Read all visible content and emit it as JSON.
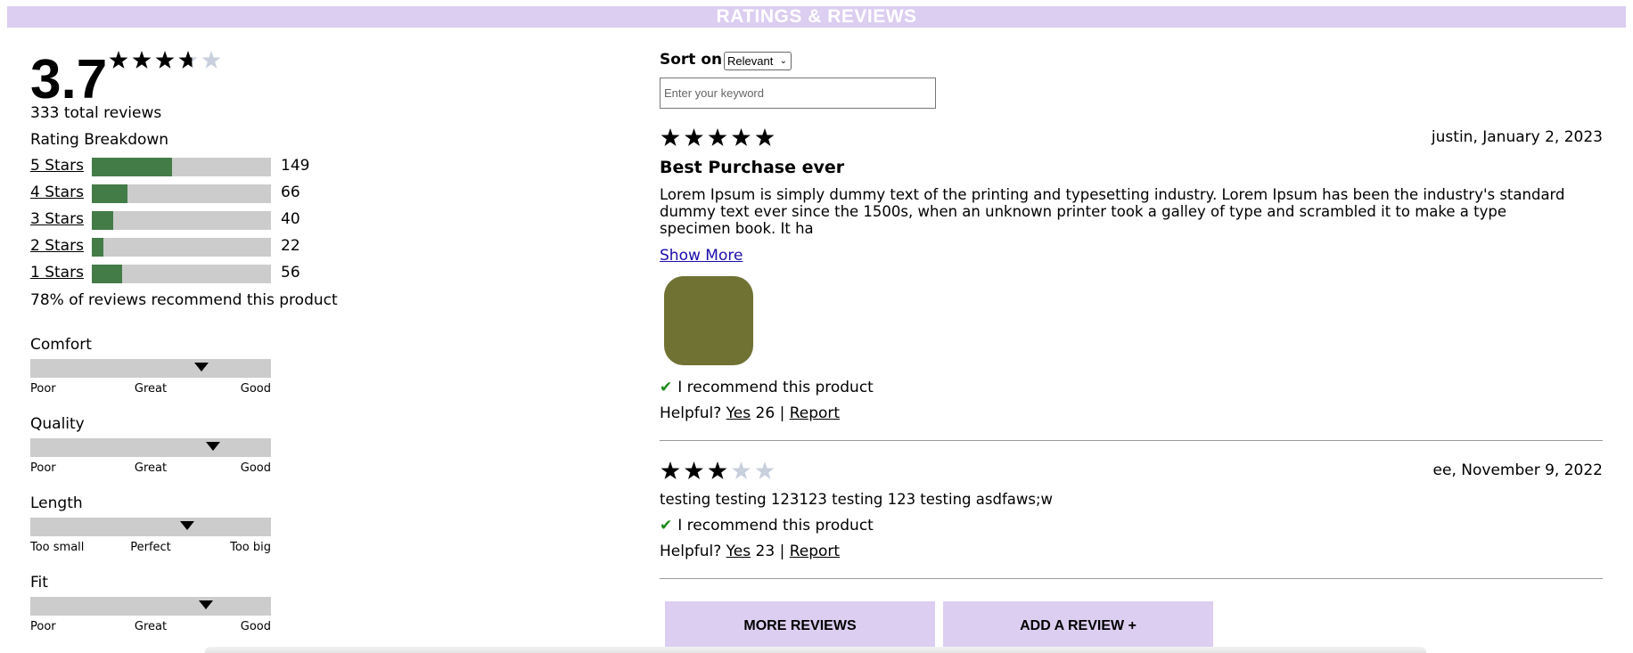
{
  "header": {
    "title": "RATINGS & REVIEWS"
  },
  "summary": {
    "average": "3.7",
    "average_value": 3.7,
    "total_reviews": "333 total reviews",
    "breakdown_title": "Rating Breakdown",
    "breakdown": [
      {
        "label": "5 Stars",
        "count": "149",
        "fraction": 0.447
      },
      {
        "label": "4 Stars",
        "count": "66",
        "fraction": 0.198
      },
      {
        "label": "3 Stars",
        "count": "40",
        "fraction": 0.12
      },
      {
        "label": "2 Stars",
        "count": "22",
        "fraction": 0.066
      },
      {
        "label": "1 Stars",
        "count": "56",
        "fraction": 0.168
      }
    ],
    "recommend_text": "78% of reviews recommend this product"
  },
  "characteristics": [
    {
      "name": "Comfort",
      "low": "Poor",
      "mid": "Great",
      "high": "Good",
      "level": 0.71
    },
    {
      "name": "Quality",
      "low": "Poor",
      "mid": "Great",
      "high": "Good",
      "level": 0.76
    },
    {
      "name": "Length",
      "low": "Too small",
      "mid": "Perfect",
      "high": "Too big",
      "level": 0.65
    },
    {
      "name": "Fit",
      "low": "Poor",
      "mid": "Great",
      "high": "Good",
      "level": 0.73
    }
  ],
  "controls": {
    "sort_label": "Sort on:",
    "sort_value": "Relevant",
    "keyword_placeholder": "Enter your keyword"
  },
  "reviews": [
    {
      "rating": 5,
      "meta": "justin, January 2, 2023",
      "summary": "Best Purchase ever",
      "body": "Lorem Ipsum is simply dummy text of the printing and typesetting industry. Lorem Ipsum has been the industry's standard dummy text ever since the 1500s, when an unknown printer took a galley of type and scrambled it to make a type specimen book. It ha",
      "show_more": "Show More",
      "photo_color": "#707234",
      "recommend": "I recommend this product",
      "helpful_label": "Helpful?",
      "yes_label": "Yes",
      "helpful_count": "26",
      "separator": "|",
      "report_label": "Report"
    },
    {
      "rating": 3,
      "meta": "ee, November 9, 2022",
      "body": "testing testing 123123 testing 123 testing asdfaws;w",
      "recommend": "I recommend this product",
      "helpful_label": "Helpful?",
      "yes_label": "Yes",
      "helpful_count": "23",
      "separator": "|",
      "report_label": "Report"
    }
  ],
  "buttons": {
    "more_reviews": "MORE REVIEWS",
    "add_review": "ADD A REVIEW +"
  },
  "colors": {
    "banner": "#dccef0",
    "bar_fill": "#447c48",
    "bar_track": "#cccccc",
    "star_filled": "#000000",
    "star_empty": "#c8d0de",
    "check": "#1a8a1a"
  },
  "icons": {
    "star": "star-icon",
    "check": "check-icon",
    "marker": "triangle-down-icon"
  }
}
